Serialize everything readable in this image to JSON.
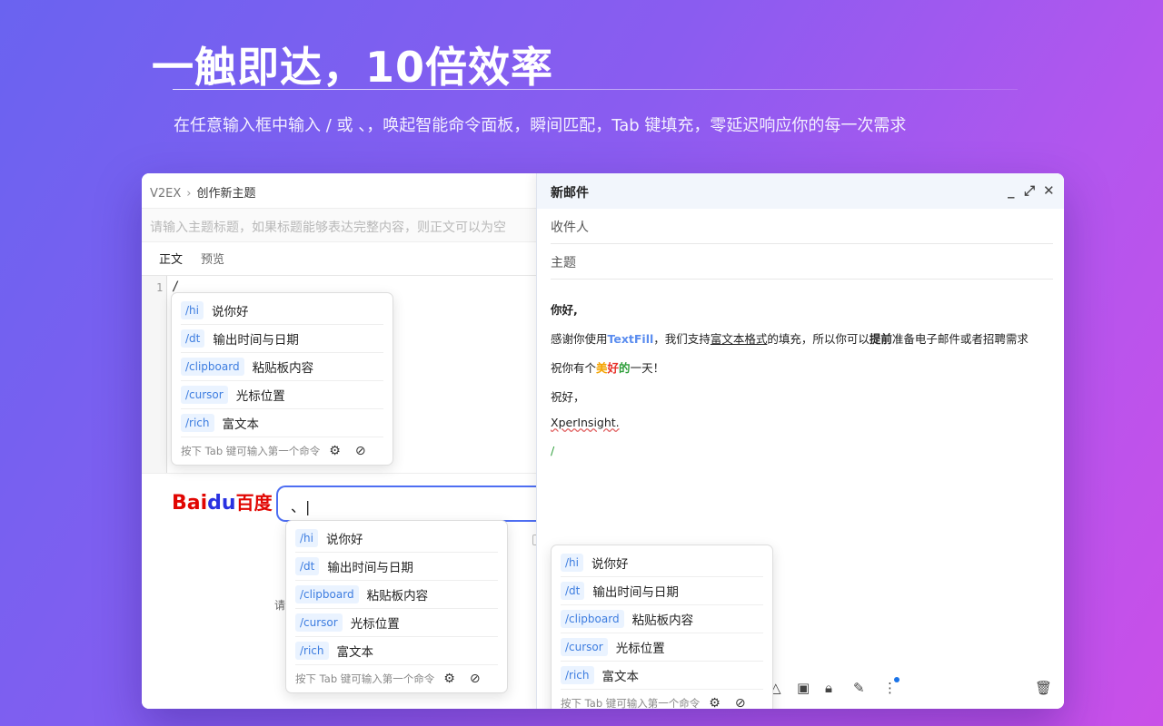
{
  "hero": {
    "title": "一触即达，10倍效率",
    "subtitle": "在任意输入框中输入 / 或 、，唤起智能命令面板，瞬间匹配，Tab 键填充，零延迟响应你的每一次需求"
  },
  "v2ex": {
    "site": "V2EX",
    "separator": "›",
    "page": "创作新主题",
    "title_placeholder": "请输入主题标题，如果标题能够表达完整内容，则正文可以为空",
    "tabs": [
      "正文",
      "预览"
    ],
    "line_number": "1",
    "editor_text": "/"
  },
  "baidu": {
    "logo_left": "Bai",
    "logo_paw": "du",
    "logo_right": "百度",
    "search_value": "、",
    "hint_text": "请"
  },
  "mail": {
    "title": "新邮件",
    "controls": [
      "_",
      "⤢",
      "✕"
    ],
    "to_label": "收件人",
    "subject_label": "主题",
    "greeting": "你好,",
    "line1_a": "感谢你使用",
    "line1_brand": "TextFill",
    "line1_b": "，我们支持",
    "line1_link": "富文本格式",
    "line1_c": "的填充，所以你可以",
    "line1_bold": "提前",
    "line1_d": "准备电子邮件或者招聘需求",
    "line2_a": "祝你有个",
    "line2_mei": "美",
    "line2_hao": "好",
    "line2_de": "的",
    "line2_b": "一天！",
    "line3": "祝好，",
    "line4": "XperInsight.",
    "line5": "/"
  },
  "popup": {
    "items": [
      {
        "cmd": "/hi",
        "label": "说你好"
      },
      {
        "cmd": "/dt",
        "label": "输出时间与日期"
      },
      {
        "cmd": "/clipboard",
        "label": "粘贴板内容"
      },
      {
        "cmd": "/cursor",
        "label": "光标位置"
      },
      {
        "cmd": "/rich",
        "label": "富文本"
      }
    ],
    "footer": "按下 Tab 键可输入第一个命令"
  },
  "colors": {
    "accent": "#3d7de0",
    "baidu_red": "#e10602",
    "baidu_blue": "#2932e1",
    "gmail_header": "#f2f6fc"
  },
  "icons": [
    "gear-icon",
    "block-icon",
    "drive-icon",
    "image-icon",
    "lock-clock-icon",
    "pen-icon",
    "more-icon",
    "trash-icon",
    "minimize-icon",
    "expand-icon",
    "close-icon"
  ]
}
